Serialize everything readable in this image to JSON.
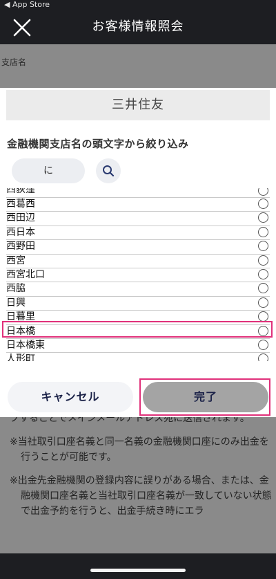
{
  "status_bar": {
    "back_label": "◀ App Store"
  },
  "header": {
    "title": "お客様情報照会",
    "close_icon": "close-icon"
  },
  "background": {
    "branch_label": "支店名",
    "notes": [
      "プすることでメインメールアドレス宛に送信されます。",
      "※当社取引口座名義と同一名義の金融機関口座にのみ出金を行うことが可能です。",
      "※出金先金融機関の登録内容に誤りがある場合、または、金融機関口座名義と当社取引口座名義が一致していない状態で出金予約を行うと、出金手続き時にエラ"
    ]
  },
  "modal": {
    "bank_name": "三井住友",
    "filter_label": "金融機関支店名の頭文字から絞り込み",
    "filter_value": "に",
    "search_icon": "search-icon",
    "branches": [
      "西荻窪",
      "西葛西",
      "西田辺",
      "西日本",
      "西野田",
      "西宮",
      "西宮北口",
      "西脇",
      "日興",
      "日暮里",
      "日本橋",
      "日本橋東",
      "人形町"
    ],
    "highlighted_branch": "日本橋",
    "cancel_label": "キャンセル",
    "done_label": "完了",
    "highlight_color": "#e0307a"
  }
}
